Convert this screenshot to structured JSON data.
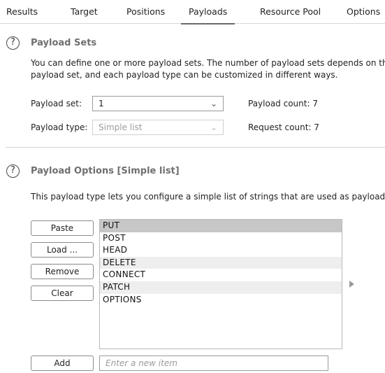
{
  "tabs": [
    {
      "label": "Results",
      "active": false
    },
    {
      "label": "Target",
      "active": false
    },
    {
      "label": "Positions",
      "active": false
    },
    {
      "label": "Payloads",
      "active": true
    },
    {
      "label": "Resource Pool",
      "active": false
    },
    {
      "label": "Options",
      "active": false
    }
  ],
  "payload_sets": {
    "help_icon": "question-mark-circle",
    "title": "Payload Sets",
    "description_line1": "You can define one or more payload sets. The number of payload sets depends on the",
    "description_line2": "payload set, and each payload type can be customized in different ways.",
    "payload_set_label": "Payload set:",
    "payload_set_value": "1",
    "payload_type_label": "Payload type:",
    "payload_type_value": "Simple list",
    "payload_count_label": "Payload count:",
    "payload_count": "7",
    "request_count_label": "Request count:",
    "request_count": "7"
  },
  "payload_options": {
    "help_icon": "question-mark-circle",
    "title": "Payload Options [Simple list]",
    "description": "This payload type lets you configure a simple list of strings that are used as payloads.",
    "buttons": {
      "paste": "Paste",
      "load": "Load ...",
      "remove": "Remove",
      "clear": "Clear",
      "add": "Add"
    },
    "items": [
      "PUT",
      "POST",
      "HEAD",
      "DELETE",
      "CONNECT",
      "PATCH",
      "OPTIONS"
    ],
    "selected_index": 0,
    "new_item_placeholder": "Enter a new item"
  },
  "colors": {
    "section_title": "#6f6f6f",
    "selected_row": "#c7c7c7",
    "alt_row": "#eeeeee",
    "active_tab_underline": "#6a6a6a"
  }
}
